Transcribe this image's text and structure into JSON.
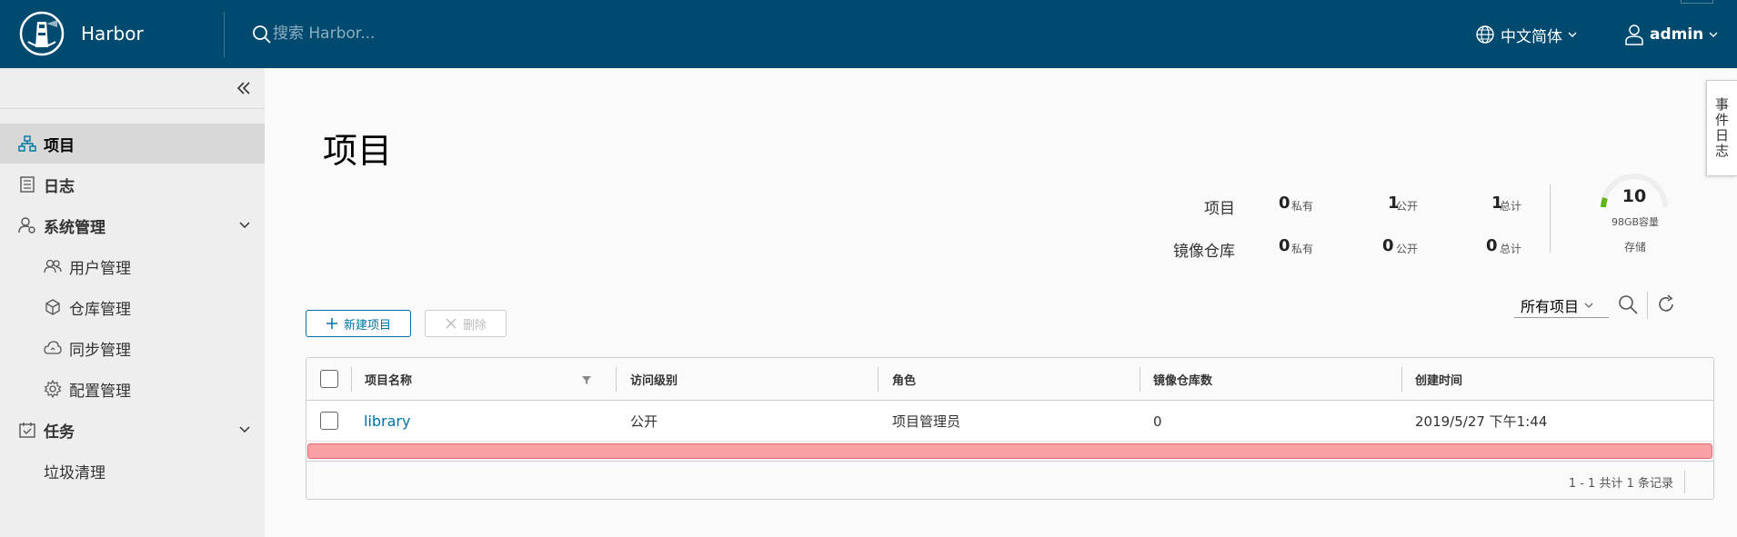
{
  "header": {
    "app_title": "Harbor",
    "search_placeholder": "搜索 Harbor...",
    "language": "中文简体",
    "user": "admin"
  },
  "sidebar": {
    "items": [
      {
        "label": "项目",
        "icon": "projects-icon",
        "active": true,
        "level": 1
      },
      {
        "label": "日志",
        "icon": "logs-icon",
        "level": 1
      },
      {
        "label": "系统管理",
        "icon": "admin-icon",
        "level": 1,
        "expanded": true
      },
      {
        "label": "用户管理",
        "icon": "users-icon",
        "level": 2
      },
      {
        "label": "仓库管理",
        "icon": "registry-icon",
        "level": 2
      },
      {
        "label": "同步管理",
        "icon": "replication-icon",
        "level": 2
      },
      {
        "label": "配置管理",
        "icon": "gear-icon",
        "level": 2
      },
      {
        "label": "任务",
        "icon": "tasks-icon",
        "level": 1,
        "expanded": true
      },
      {
        "label": "垃圾清理",
        "level": 2
      }
    ]
  },
  "main": {
    "title": "项目",
    "stats": {
      "projects_label": "项目",
      "repos_label": "镜像仓库",
      "projects": {
        "private": "0",
        "public": "1",
        "total": "1"
      },
      "repos": {
        "private": "0",
        "public": "0",
        "total": "0"
      },
      "private_label": "私有",
      "public_label": "公开",
      "total_label": "总计"
    },
    "storage": {
      "value": "10",
      "capacity": "98GB容量",
      "label": "存储"
    },
    "actions": {
      "new_project": "新建项目",
      "delete": "删除"
    },
    "filter": {
      "selected": "所有项目"
    },
    "table": {
      "columns": [
        "项目名称",
        "访问级别",
        "角色",
        "镜像仓库数",
        "创建时间"
      ],
      "rows": [
        {
          "name": "library",
          "access": "公开",
          "role": "项目管理员",
          "repo_count": "0",
          "created": "2019/5/27 下午1:44"
        }
      ],
      "footer": "1 - 1 共计 1 条记录"
    }
  },
  "event_tab": "事件日志",
  "colors": {
    "header_bg": "#004a70",
    "accent": "#0072a3",
    "sidebar_bg": "#eeeeee",
    "error_bar": "#f8a1a5"
  }
}
